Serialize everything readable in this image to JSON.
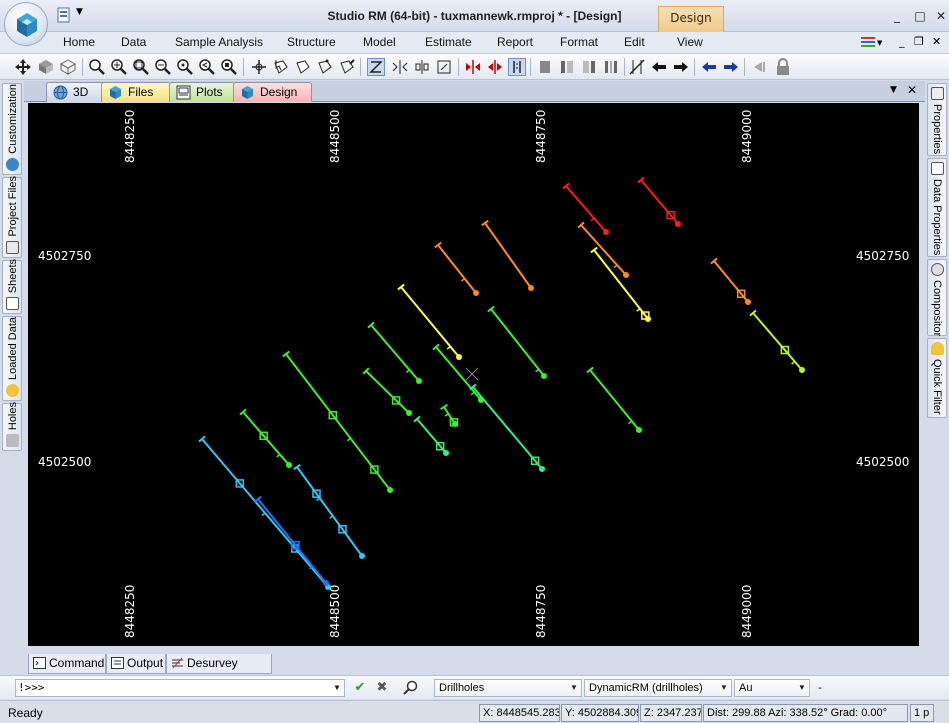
{
  "window": {
    "title": "Studio RM (64-bit) - tuxmannewk.rmproj * - [Design]",
    "context_tab": "Design",
    "min_glyph": "_",
    "max_glyph": "□",
    "close_glyph": "✕"
  },
  "menu": {
    "items": [
      "Home",
      "Data",
      "Sample Analysis",
      "Structure",
      "Model",
      "Estimate",
      "Report",
      "Format",
      "Edit",
      "View"
    ],
    "mdi_min": "_",
    "mdi_restore": "❐",
    "mdi_close": "✕"
  },
  "left_dock": {
    "tabs": [
      "Customization",
      "Project Files",
      "Sheets",
      "Loaded Data",
      "Holes"
    ]
  },
  "right_dock": {
    "tabs": [
      "Properties",
      "Data Properties",
      "Compositor",
      "Quick Filter"
    ]
  },
  "doc_tabs": {
    "tabs": [
      "3D",
      "Files",
      "Plots",
      "Design"
    ],
    "active": "Design",
    "pin_glyph": "▼",
    "close_glyph": "✕"
  },
  "viewport": {
    "grid_labels_x": [
      "8448250",
      "8448500",
      "8448750",
      "8449000"
    ],
    "grid_labels_y": [
      "4502750",
      "4502500"
    ],
    "background": "#000000",
    "label_color": "#ffffff"
  },
  "bottom_tabs": [
    "Command",
    "Output",
    "Desurvey Report"
  ],
  "command_bar": {
    "prompt": "!>>>",
    "object_combo": "Drillholes",
    "legend_combo": "DynamicRM (drillholes)",
    "field_combo": "Au",
    "extra": "-"
  },
  "status": {
    "ready": "Ready",
    "x": "X: 8448545.283",
    "y": "Y: 4502884.309",
    "z": "Z: 2347.237",
    "orientation": "Dist: 299.88 Azi: 338.52° Grad: 0.00°",
    "page": "1 p"
  },
  "drillholes": {
    "colors": {
      "red": "#ff1a1a",
      "orange": "#ff8a1a",
      "yellow": "#ffff33",
      "yellow_green": "#b7f52a",
      "green": "#3cf028",
      "spring_green": "#2ef07a",
      "sky": "#2ec8f5",
      "blue": "#1f72f5"
    }
  }
}
